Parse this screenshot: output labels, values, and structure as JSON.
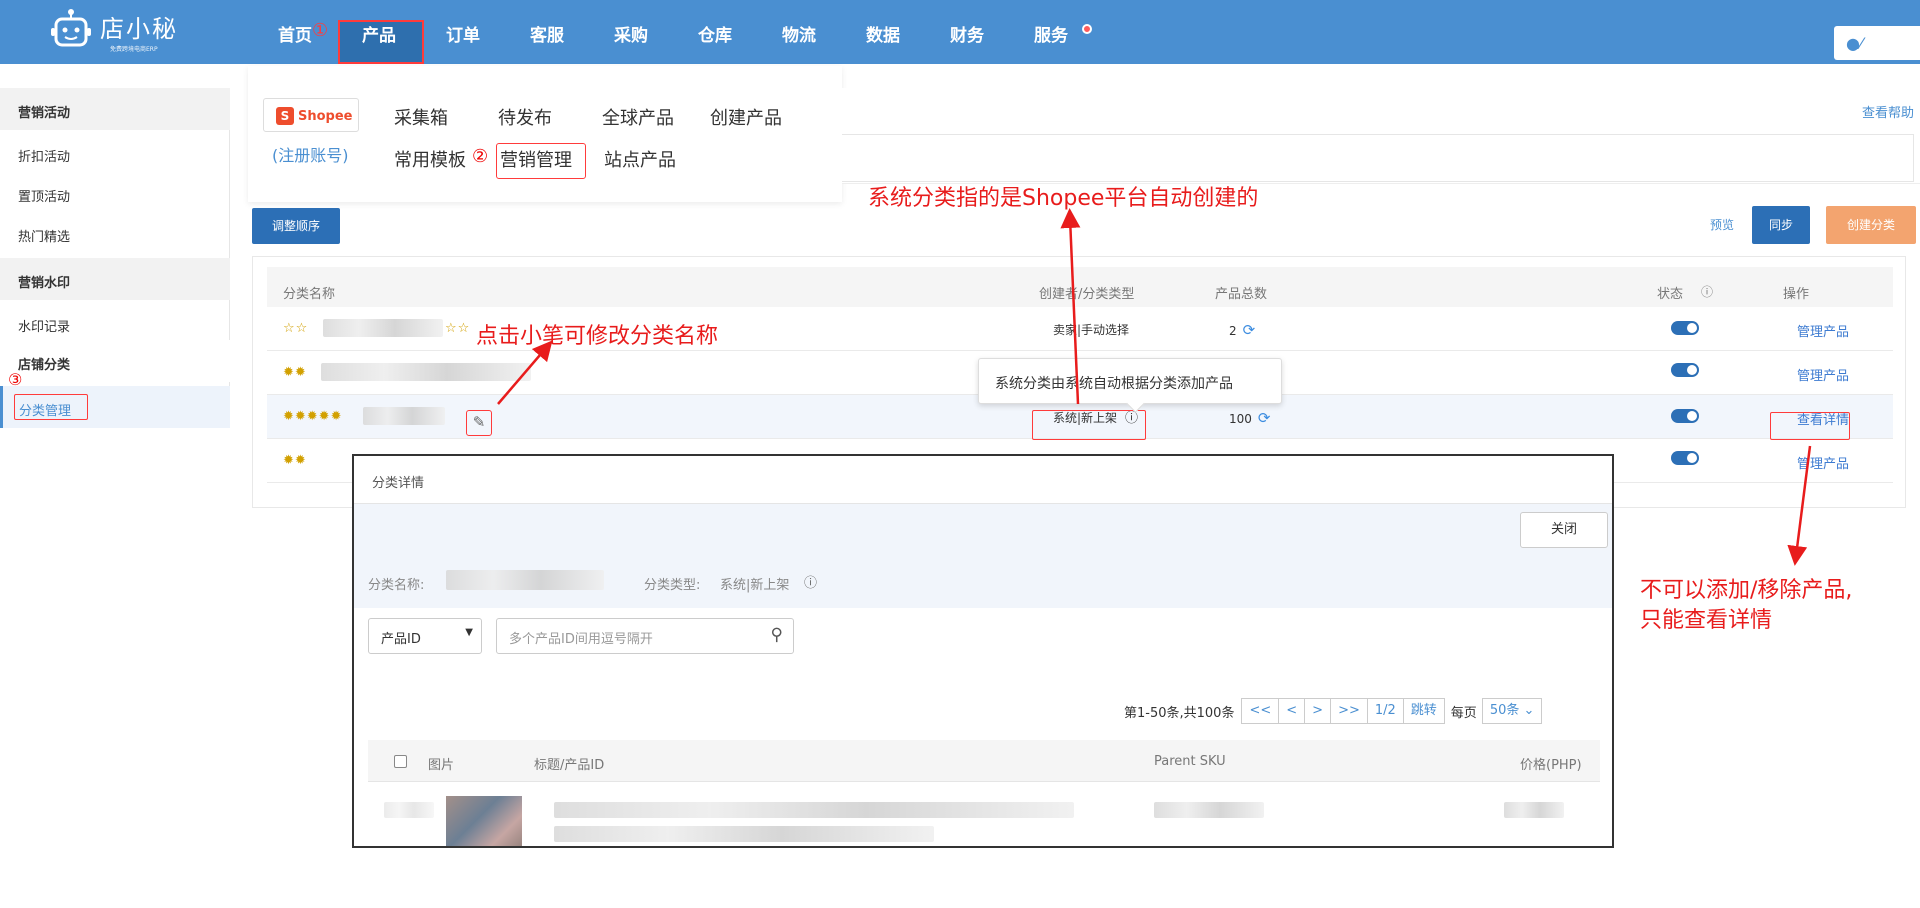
{
  "app": {
    "name": "店小秘",
    "tagline": "免费跨境电商ERP"
  },
  "nav": {
    "items": [
      "首页",
      "产品",
      "订单",
      "客服",
      "采购",
      "仓库",
      "物流",
      "数据",
      "财务",
      "服务"
    ],
    "annotation_1": "①"
  },
  "sidebar": {
    "groups": [
      {
        "title": "营销活动",
        "items": [
          "折扣活动",
          "置顶活动",
          "热门精选"
        ]
      },
      {
        "title": "营销水印",
        "items": [
          "水印记录"
        ]
      },
      {
        "title": "店铺分类",
        "items": [
          "分类管理"
        ]
      }
    ],
    "annotation_3": "③"
  },
  "dropdown": {
    "platform": "Shopee",
    "register": "(注册账号)",
    "row1": [
      "采集箱",
      "待发布",
      "全球产品",
      "创建产品"
    ],
    "row2_a": "常用模板",
    "row2_b": "营销管理",
    "row2_c": "站点产品",
    "annotation_2": "②"
  },
  "help": {
    "label": "查看帮助"
  },
  "toolbar": {
    "reorder": "调整顺序",
    "preview": "预览",
    "sync": "同步",
    "create": "创建分类"
  },
  "table": {
    "headers": {
      "name": "分类名称",
      "creator": "创建者/分类类型",
      "total": "产品总数",
      "status": "状态",
      "action": "操作"
    },
    "rows": [
      {
        "stars": "☆☆",
        "stars2": "☆☆",
        "creator": "卖家|手动选择",
        "total": "2",
        "action": "管理产品"
      },
      {
        "stars": "✹✹",
        "creator": "",
        "total": "",
        "action": "管理产品"
      },
      {
        "stars": "✹✹✹✹✹",
        "creator": "系统|新上架",
        "total": "100",
        "action": "查看详情"
      },
      {
        "stars": "✹✹",
        "creator": "",
        "total": "",
        "action": "管理产品"
      }
    ]
  },
  "tooltip": {
    "text": "系统分类由系统自动根据分类添加产品"
  },
  "annotations": {
    "system_category": "系统分类指的是Shopee平台自动创建的",
    "pencil": "点击小笔可修改分类名称",
    "no_add_1": "不可以添加/移除产品,",
    "no_add_2": "只能查看详情"
  },
  "modal": {
    "title": "分类详情",
    "close": "关闭",
    "name_label": "分类名称:",
    "type_label": "分类类型:",
    "type_value": "系统|新上架",
    "select_value": "产品ID",
    "search_placeholder": "多个产品ID间用逗号隔开",
    "pager": {
      "summary": "第1-50条,共100条",
      "first": "<<",
      "prev": "<",
      "next": ">",
      "last": ">>",
      "page": "1/2",
      "jump": "跳转",
      "per_page_label": "每页",
      "per_page": "50条"
    },
    "headers": {
      "image": "图片",
      "title": "标题/产品ID",
      "parent_sku": "Parent SKU",
      "price": "价格(PHP)"
    }
  },
  "colors": {
    "topbar": "#4a8fd1",
    "accent": "#2c6fb6",
    "annotation": "#e81c1c",
    "create_button": "#f3a46f"
  }
}
